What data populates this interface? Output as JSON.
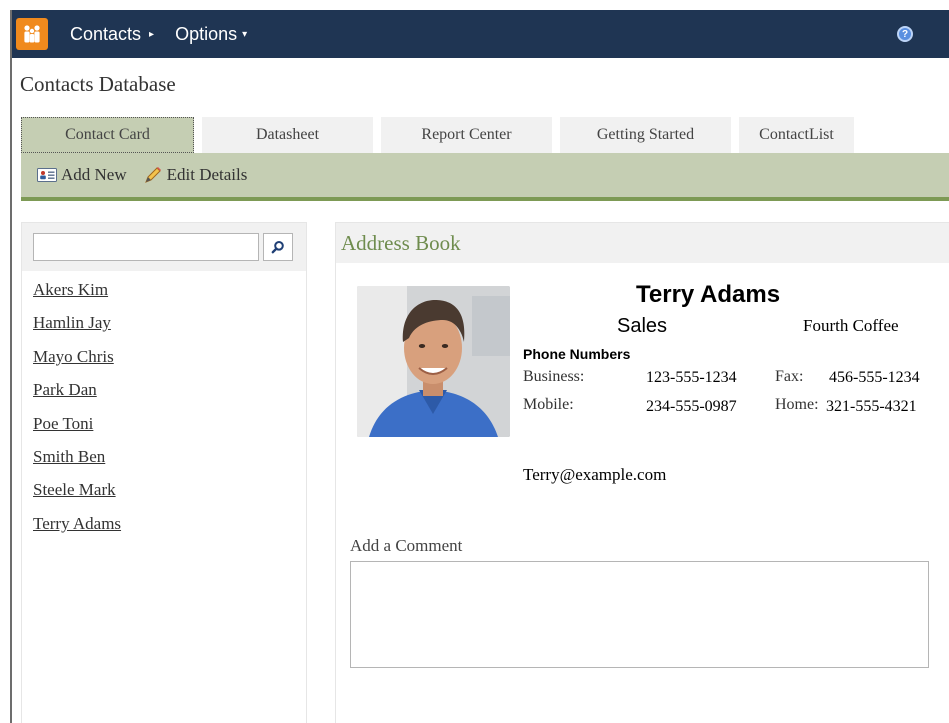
{
  "topbar": {
    "app_icon": "contacts-app-icon",
    "nav": [
      {
        "label": "Contacts",
        "caret": "▸"
      },
      {
        "label": "Options",
        "caret": "▾"
      }
    ],
    "help_icon": "help-icon",
    "help_glyph": "?"
  },
  "page": {
    "title": "Contacts Database"
  },
  "tabs": [
    {
      "label": "Contact Card",
      "active": true
    },
    {
      "label": "Datasheet"
    },
    {
      "label": "Report Center"
    },
    {
      "label": "Getting Started"
    },
    {
      "label": "ContactList"
    }
  ],
  "toolbar": {
    "add_new": "Add New",
    "edit_details": "Edit Details"
  },
  "search": {
    "value": "",
    "icon": "search-icon"
  },
  "contacts": [
    "Akers Kim",
    "Hamlin Jay",
    "Mayo Chris",
    "Park Dan",
    "Poe Toni",
    "Smith Ben",
    "Steele Mark",
    "Terry Adams"
  ],
  "address_book": {
    "heading": "Address Book",
    "name": "Terry Adams",
    "department": "Sales",
    "company": "Fourth Coffee",
    "phone_heading": "Phone Numbers",
    "business_label": "Business:",
    "business": "123-555-1234",
    "mobile_label": "Mobile:",
    "mobile": "234-555-0987",
    "fax_label": "Fax:",
    "fax": "456-555-1234",
    "home_label": "Home:",
    "home": "321-555-4321",
    "email": "Terry@example.com"
  },
  "comment": {
    "label": "Add a Comment",
    "value": ""
  },
  "colors": {
    "topbar": "#1f3553",
    "accent_green": "#6f8c4e",
    "toolbar_bg": "#c5ceb3",
    "toolbar_rule": "#7d9a55",
    "app_icon": "#f08a1d"
  }
}
